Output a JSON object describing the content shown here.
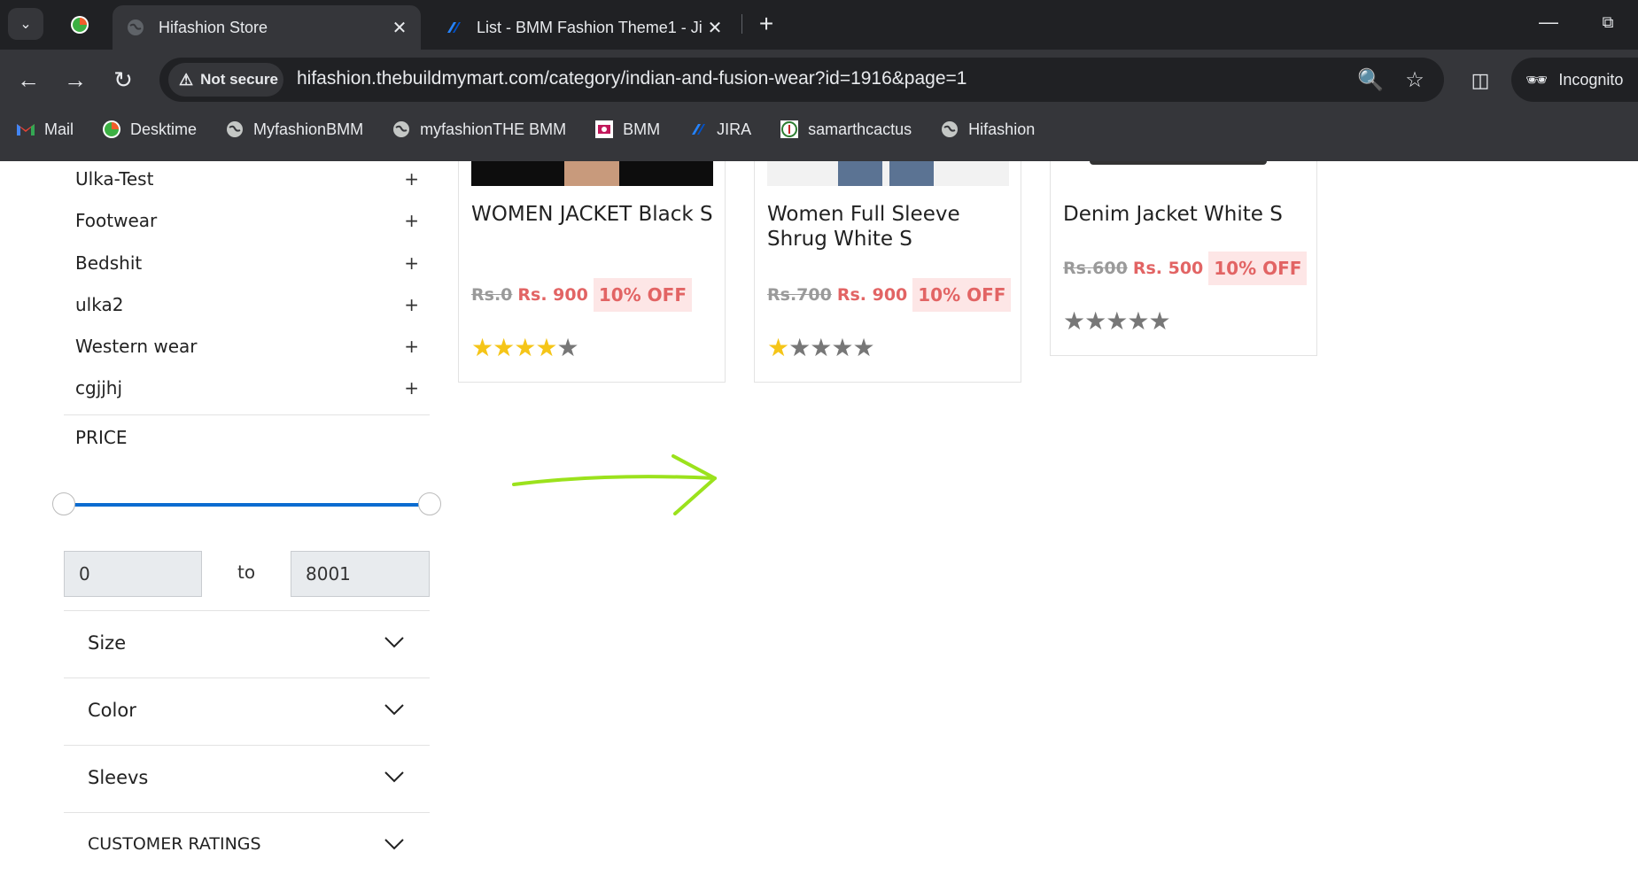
{
  "browser": {
    "tabs": [
      {
        "title": "Hifashion Store",
        "active": true,
        "close": "✕"
      },
      {
        "title": "List - BMM Fashion Theme1 - Ji",
        "active": false,
        "close": "✕"
      }
    ],
    "new_tab": "+",
    "security_label": "Not secure",
    "url": "hifashion.thebuildmymart.com/category/indian-and-fusion-wear?id=1916&page=1",
    "profile_label": "Incognito",
    "bookmarks": [
      {
        "label": "Mail",
        "icon": "gmail-icon"
      },
      {
        "label": "Desktime",
        "icon": "desktime-icon"
      },
      {
        "label": "MyfashionBMM",
        "icon": "globe-icon"
      },
      {
        "label": "myfashionTHE BMM",
        "icon": "globe-icon"
      },
      {
        "label": "BMM",
        "icon": "bmm-icon"
      },
      {
        "label": "JIRA",
        "icon": "jira-icon"
      },
      {
        "label": "samarthcactus",
        "icon": "cactus-icon"
      },
      {
        "label": "Hifashion",
        "icon": "globe-icon"
      }
    ]
  },
  "sidebar": {
    "categories": [
      {
        "label": "Ulka-Test",
        "toggle": "+"
      },
      {
        "label": "Footwear",
        "toggle": "+"
      },
      {
        "label": "Bedshit",
        "toggle": "+"
      },
      {
        "label": "ulka2",
        "toggle": "+"
      },
      {
        "label": "Western wear",
        "toggle": "+"
      },
      {
        "label": "cgjjhj",
        "toggle": "+"
      }
    ],
    "price": {
      "title": "PRICE",
      "min": "0",
      "max": "8001",
      "separator": "to"
    },
    "filters": [
      {
        "label": "Size"
      },
      {
        "label": "Color"
      },
      {
        "label": "Sleevs"
      },
      {
        "label": "CUSTOMER RATINGS"
      }
    ]
  },
  "products": [
    {
      "name": "WOMEN JACKET Black S",
      "old_price": "Rs.0",
      "price": "Rs. 900",
      "discount": "10% OFF",
      "rating": 4,
      "max_rating": 5
    },
    {
      "name": "Women Full Sleeve Shrug White S",
      "old_price": "Rs.700",
      "price": "Rs. 900",
      "discount": "10% OFF",
      "rating": 1,
      "max_rating": 5
    },
    {
      "name": "Denim Jacket White S",
      "old_price": "Rs.600",
      "price": "Rs. 500",
      "discount": "10% OFF",
      "rating": 0,
      "max_rating": 5
    }
  ],
  "colors": {
    "chrome_bg": "#202124",
    "chrome_toolbar": "#35363a",
    "slider": "#0b6cd0",
    "discount_text": "#e26464",
    "discount_bg": "#fde6e6",
    "star_on": "#f5c518",
    "star_off": "#777777",
    "annotation_arrow": "#9be21c"
  }
}
